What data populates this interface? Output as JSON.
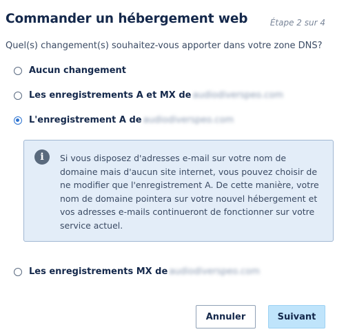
{
  "header": {
    "title": "Commander un hébergement web",
    "step": "Étape 2 sur 4"
  },
  "question": "Quel(s) changement(s) souhaitez-vous apporter dans votre zone DNS?",
  "options": [
    {
      "label": "Aucun changement",
      "domain": "",
      "checked": false
    },
    {
      "label": "Les enregistrements A et MX de",
      "domain": "audiodiverspeo.com",
      "checked": false
    },
    {
      "label": "L'enregistrement A de",
      "domain": "audiodiverspeo.com",
      "checked": true
    },
    {
      "label": "Les enregistrements MX de",
      "domain": "audiodiverspeo.com",
      "checked": false
    }
  ],
  "info": {
    "icon": "info-icon",
    "text": "Si vous disposez d'adresses e-mail sur votre nom de domaine mais d'aucun site internet, vous pouvez choisir de ne modifier que l'enregistrement A. De cette manière, votre nom de domaine pointera sur votre nouvel hébergement et vos adresses e-mails continueront de fonctionner sur votre service actuel."
  },
  "buttons": {
    "cancel": "Annuler",
    "next": "Suivant"
  },
  "colors": {
    "accent": "#2c73d1",
    "info_bg": "#e3edf8",
    "primary_button": "#bfe4fb"
  }
}
